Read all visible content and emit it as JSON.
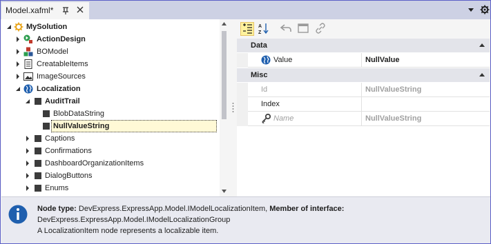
{
  "tab": {
    "title": "Model.xafml*"
  },
  "tree": {
    "items": [
      {
        "label": "MySolution",
        "bold": true,
        "icon": "solution-gear-icon"
      },
      {
        "label": "ActionDesign",
        "bold": true,
        "icon": "action-design-icon"
      },
      {
        "label": "BOModel",
        "bold": false,
        "icon": "bomodel-icon"
      },
      {
        "label": "CreatableItems",
        "bold": false,
        "icon": "list-icon"
      },
      {
        "label": "ImageSources",
        "bold": false,
        "icon": "image-icon"
      },
      {
        "label": "Localization",
        "bold": true,
        "icon": "globe-icon"
      },
      {
        "label": "AuditTrail",
        "bold": true,
        "icon": "square-icon"
      },
      {
        "label": "BlobDataString",
        "bold": false,
        "icon": "square-icon"
      },
      {
        "label": "NullValueString",
        "bold": true,
        "icon": "square-icon"
      },
      {
        "label": "Captions",
        "bold": false,
        "icon": "square-icon"
      },
      {
        "label": "Confirmations",
        "bold": false,
        "icon": "square-icon"
      },
      {
        "label": "DashboardOrganizationItems",
        "bold": false,
        "icon": "square-icon"
      },
      {
        "label": "DialogButtons",
        "bold": false,
        "icon": "square-icon"
      },
      {
        "label": "Enums",
        "bold": false,
        "icon": "square-icon"
      }
    ]
  },
  "properties": {
    "categories": [
      {
        "name": "Data"
      },
      {
        "name": "Misc"
      }
    ],
    "rows": [
      {
        "name": "Value",
        "value": "NullValue"
      },
      {
        "name": "Id",
        "value": "NullValueString"
      },
      {
        "name": "Index",
        "value": ""
      },
      {
        "name": "Name",
        "value": "NullValueString"
      }
    ]
  },
  "info": {
    "node_type_label": "Node type:",
    "node_type_value": "DevExpress.ExpressApp.Model.IModelLocalizationItem,",
    "member_label": "Member of interface:",
    "member_value": "DevExpress.ExpressApp.Model.IModelLocalizationGroup",
    "description": "A LocalizationItem node represents a localizable item."
  },
  "colors": {
    "accent": "#5b5fc7",
    "selection": "#fff9d6",
    "category_bg": "#e3e4ea",
    "info_bg": "#e9eaf1"
  }
}
